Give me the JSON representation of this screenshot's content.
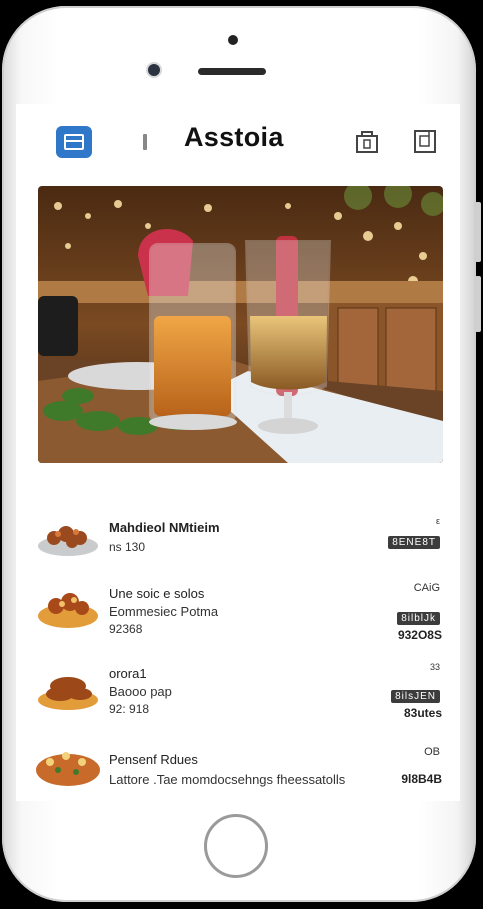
{
  "header": {
    "title": "Asstoia",
    "menu_icon": "menu-icon",
    "right_icons": [
      "bag-icon",
      "document-icon"
    ]
  },
  "hero": {
    "alt": "Two drinks on a bar table"
  },
  "menu": {
    "items": [
      {
        "name": "Mahdieol NMtieim",
        "line2": "ns 130",
        "tag": "",
        "price_label": "8ENE8T",
        "price_top": "ε"
      },
      {
        "name": "Une soic e solos",
        "line2": "Eommesiec Potma",
        "line3": "92368",
        "right_top": "CAiG",
        "tag": "8ilblJk",
        "price": "932O8S"
      },
      {
        "name": "orora1",
        "line2": "Baooo pap",
        "line3": "92: 918",
        "right_top": "33",
        "tag": "8ilsJEN",
        "price": "83utes"
      },
      {
        "name": "Pensenf Rdues",
        "line2": "Lattore .Tae momdocsehngs fheessatolls",
        "right_top": "OB",
        "price": "9l8B4B"
      }
    ]
  },
  "colors": {
    "accent": "#2f77c9",
    "text": "#111111"
  }
}
